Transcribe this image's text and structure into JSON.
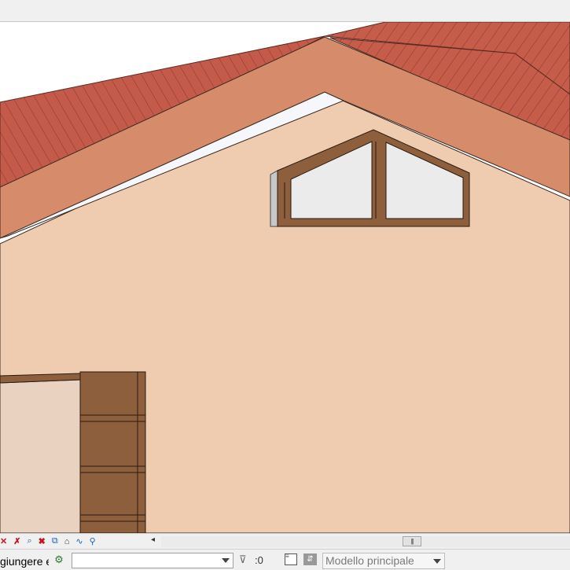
{
  "status_bar": {
    "prompt_text": "giungere e",
    "filter_count": ":0",
    "design_option": "Modello principale"
  },
  "view_controls": {
    "icons": [
      "delete-icon",
      "remove-tag-icon",
      "tag-icon",
      "hide-icon",
      "reveal-icon",
      "house-icon",
      "analysis-icon",
      "location-pin-icon"
    ],
    "scroll_left_glyph": "◂",
    "scroll_thumb_glyph": "|||"
  },
  "colors": {
    "wall": "#efcbb0",
    "fascia": "#d68b6b",
    "roof": "#c45a4a",
    "frame": "#8e5f3d",
    "glass": "#ebebeb"
  }
}
